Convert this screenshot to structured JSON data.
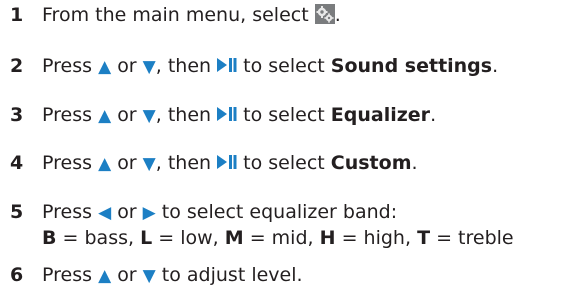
{
  "steps": [
    {
      "number": "1",
      "text_before": "From the main menu, select",
      "icon": "settings-gear-icon",
      "text_after": "."
    },
    {
      "number": "2",
      "press": "Press",
      "or": "or",
      "then": ", then",
      "to_select": "to select",
      "target": "Sound settings",
      "end": "."
    },
    {
      "number": "3",
      "press": "Press",
      "or": "or",
      "then": ", then",
      "to_select": "to select",
      "target": "Equalizer",
      "end": "."
    },
    {
      "number": "4",
      "press": "Press",
      "or": "or",
      "then": ", then",
      "to_select": "to select",
      "target": "Custom",
      "end": "."
    },
    {
      "number": "5",
      "press": "Press",
      "or": "or",
      "to_select": "to select equalizer band:",
      "bands": [
        {
          "key": "B",
          "eq": "= bass,"
        },
        {
          "key": "L",
          "eq": "= low,"
        },
        {
          "key": "M",
          "eq": "= mid,"
        },
        {
          "key": "H",
          "eq": "= high,"
        },
        {
          "key": "T",
          "eq": "= treble"
        }
      ]
    },
    {
      "number": "6",
      "press": "Press",
      "or": "or",
      "rest": "to adjust level."
    }
  ],
  "colors": {
    "text": "#231f20",
    "accent": "#1c7fc4"
  },
  "icons": {
    "up": "triangle-up-icon",
    "down": "triangle-down-icon",
    "left": "triangle-left-icon",
    "right": "triangle-right-icon",
    "play_pause": "play-pause-icon"
  }
}
